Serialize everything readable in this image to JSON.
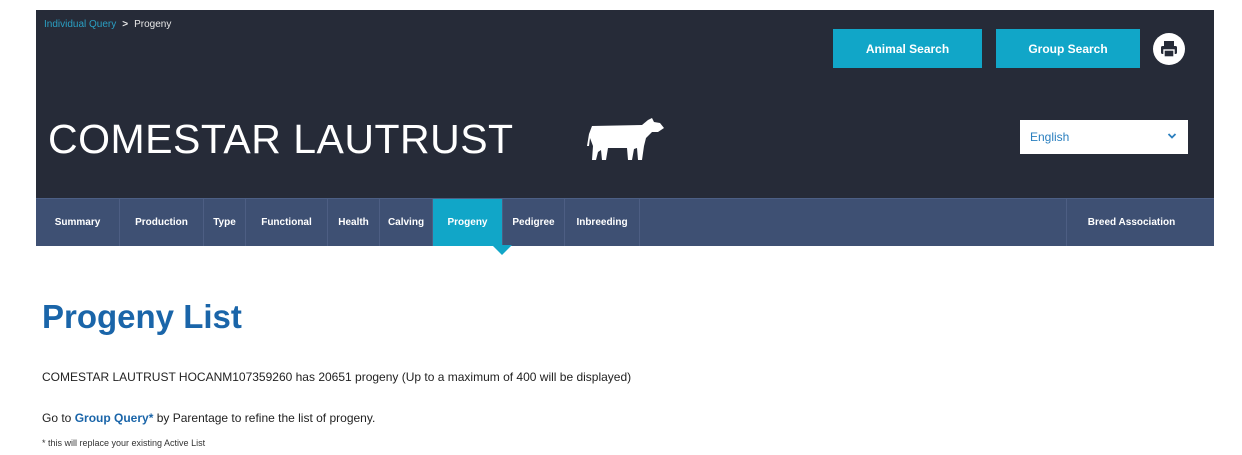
{
  "breadcrumb": {
    "link": "Individual Query",
    "separator": ">",
    "current": "Progeny"
  },
  "header": {
    "animal_search_label": "Animal Search",
    "group_search_label": "Group Search",
    "print_icon": "print-icon",
    "title": "COMESTAR LAUTRUST",
    "animal_icon": "cow-icon",
    "language": "English"
  },
  "tabs": [
    {
      "label": "Summary"
    },
    {
      "label": "Production"
    },
    {
      "label": "Type"
    },
    {
      "label": "Functional"
    },
    {
      "label": "Health"
    },
    {
      "label": "Calving"
    },
    {
      "label": "Progeny"
    },
    {
      "label": "Pedigree"
    },
    {
      "label": "Inbreeding"
    },
    {
      "label": "Breed Association"
    }
  ],
  "active_tab": "Progeny",
  "main": {
    "heading": "Progeny List",
    "summary": "COMESTAR LAUTRUST HOCANM107359260 has 20651 progeny (Up to a maximum of 400 will be displayed)",
    "goto_prefix": "Go to ",
    "goto_link": "Group Query*",
    "goto_suffix": " by Parentage to refine the list of progeny.",
    "note": "* this will replace your existing Active List"
  },
  "colors": {
    "header_bg": "#262b38",
    "tabbar_bg": "#3e5073",
    "accent": "#11a6c8",
    "heading": "#1a65a9"
  }
}
